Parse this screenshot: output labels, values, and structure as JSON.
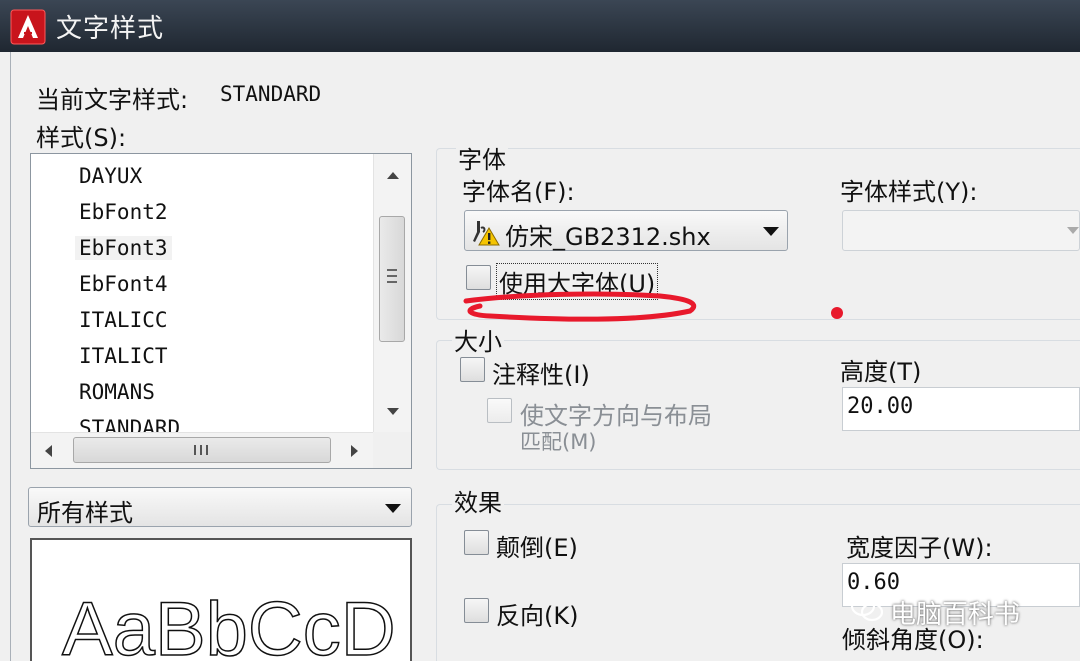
{
  "window": {
    "title": "文字样式"
  },
  "current_style": {
    "label": "当前文字样式:",
    "value": "STANDARD"
  },
  "styles": {
    "label": "样式(S):",
    "items": [
      "DAYUX",
      "EbFont2",
      "EbFont3",
      "EbFont4",
      "ITALICC",
      "ITALICT",
      "ROMANS",
      "STANDARD"
    ],
    "selected": "EbFont3"
  },
  "filter": {
    "value": "所有样式"
  },
  "preview": {
    "text": "AaBbCcD"
  },
  "font": {
    "group_label": "字体",
    "name_label": "字体名(F):",
    "name_value": "仿宋_GB2312.shx",
    "style_label": "字体样式(Y):",
    "style_value": "",
    "use_big_font_label": "使用大字体(U)",
    "use_big_font_checked": false
  },
  "size": {
    "group_label": "大小",
    "annotative_label": "注释性(I)",
    "annotative_checked": false,
    "match_orientation_label_1": "使文字方向与布局",
    "match_orientation_label_2": "匹配(M)",
    "height_label": "高度(T)",
    "height_value": "20.00"
  },
  "effects": {
    "group_label": "效果",
    "upside_down_label": "颠倒(E)",
    "backwards_label": "反向(K)",
    "width_factor_label": "宽度因子(W):",
    "width_factor_value": "0.60",
    "oblique_label": "倾斜角度(O):"
  },
  "watermark": {
    "text": "电脑百科书"
  },
  "colors": {
    "title_bar": "#2b3440",
    "annotation_red": "#e8192c",
    "autocad_red": "#d81e1e"
  }
}
